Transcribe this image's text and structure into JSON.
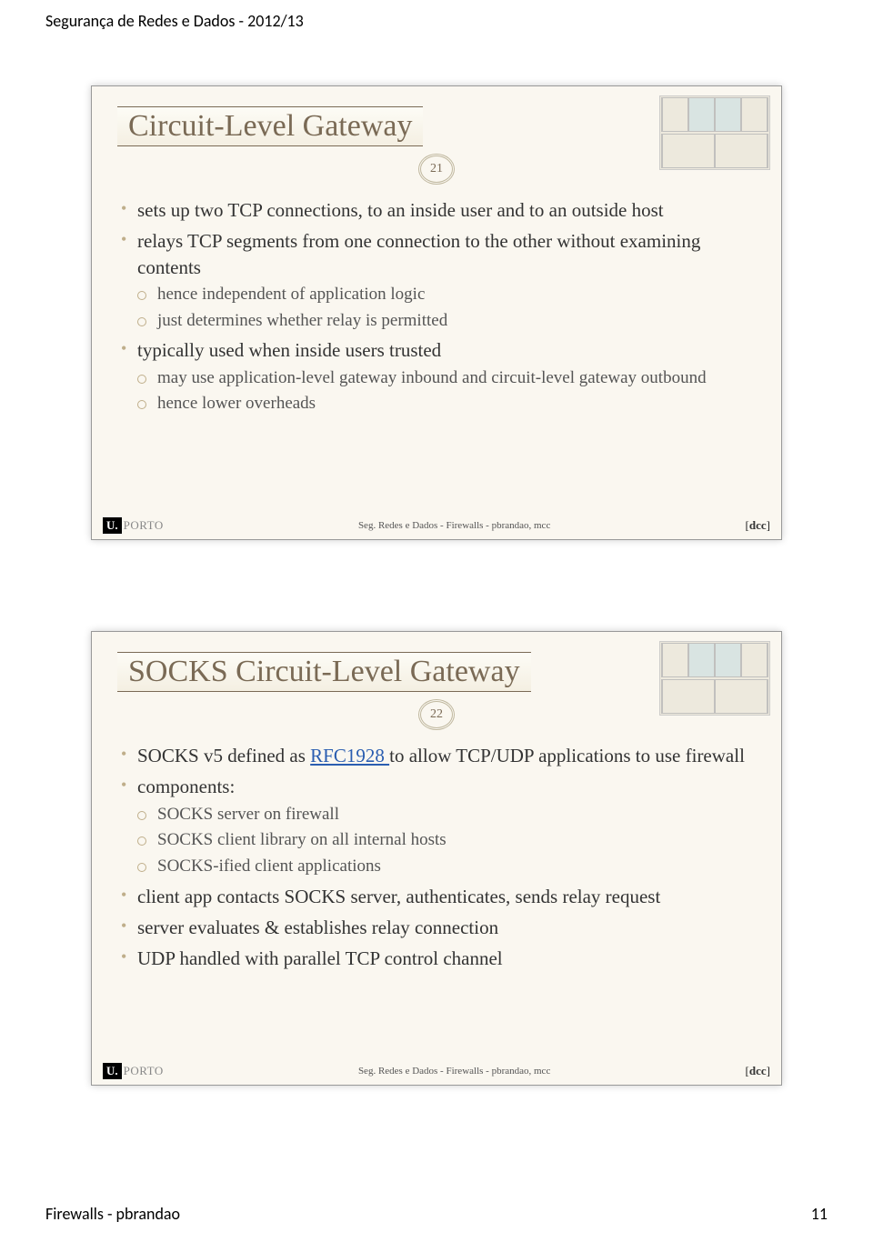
{
  "document": {
    "header": "Segurança de Redes e Dados - 2012/13",
    "footer_left": "Firewalls - pbrandao",
    "footer_right": "11"
  },
  "slide21": {
    "title": "Circuit-Level Gateway",
    "number": "21",
    "bullets": [
      {
        "text": "sets up two TCP connections, to an inside user and to an outside host"
      },
      {
        "text": "relays TCP segments from one connection to the other without examining contents",
        "sub": [
          "hence independent of application logic",
          "just determines whether relay is permitted"
        ]
      },
      {
        "text": "typically used when inside users trusted",
        "sub": [
          "may use application-level gateway inbound and circuit-level gateway outbound",
          "hence lower overheads"
        ]
      }
    ],
    "footer_center": "Seg. Redes e Dados - Firewalls - pbrandao, mcc",
    "logo_u": "U.",
    "logo_porto": "PORTO",
    "logo_dcc": "dcc"
  },
  "slide22": {
    "title": "SOCKS Circuit-Level Gateway",
    "number": "22",
    "bullets": [
      {
        "text_pre": "SOCKS v5 defined as ",
        "link": "RFC1928 ",
        "text_post": "to allow TCP/UDP applications to use firewall"
      },
      {
        "text": "components:",
        "sub": [
          "SOCKS server on firewall",
          "SOCKS client library on all internal hosts",
          "SOCKS-ified client applications"
        ]
      },
      {
        "text": "client app contacts SOCKS server, authenticates, sends relay request"
      },
      {
        "text": "server evaluates & establishes relay connection"
      },
      {
        "text": "UDP handled with parallel TCP control channel"
      }
    ],
    "footer_center": "Seg. Redes e Dados - Firewalls - pbrandao, mcc",
    "logo_u": "U.",
    "logo_porto": "PORTO",
    "logo_dcc": "dcc"
  }
}
